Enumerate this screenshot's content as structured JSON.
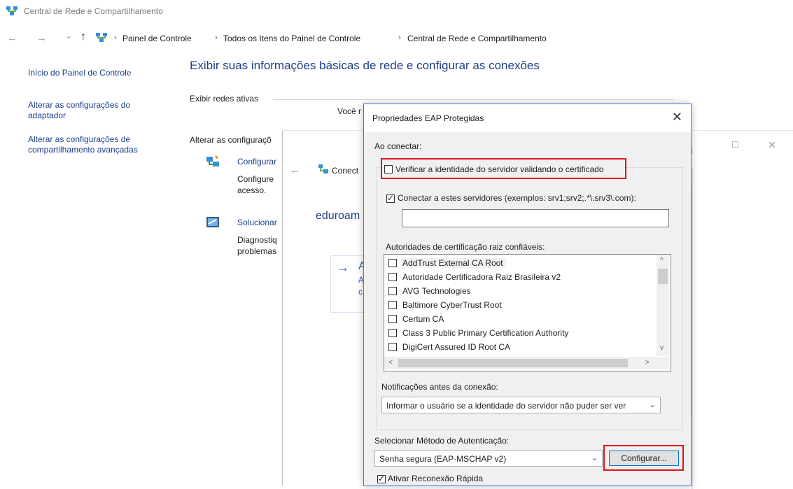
{
  "window": {
    "title": "Central de Rede e Compartilhamento"
  },
  "nav": {
    "back_glyph": "←",
    "forward_glyph": "→",
    "recent_glyph": "⌄",
    "up_glyph": "↑",
    "breadcrumb": [
      "Painel de Controle",
      "Todos os Itens do Painel de Controle",
      "Central de Rede e Compartilhamento"
    ],
    "separator": "›"
  },
  "sidebar": {
    "items": [
      {
        "label_1": "Início do Painel de Controle",
        "label_2": ""
      },
      {
        "label_1": "Alterar as configurações do",
        "label_2": "adaptador"
      },
      {
        "label_1": "Alterar as configurações de",
        "label_2": "compartilhamento avançadas"
      }
    ]
  },
  "main": {
    "heading": "Exibir suas informações básicas de rede e configurar as conexões",
    "active_networks_label": "Exibir redes ativas",
    "you_partial": "Você r",
    "change_settings_label": "Alterar as configuraçõ",
    "task1": {
      "link": "Configurar",
      "line1": "Configure",
      "line2": "acesso."
    },
    "task2": {
      "link": "Solucionar",
      "line1": "Diagnostiq",
      "line2": "problemas"
    }
  },
  "middle_window": {
    "back_glyph": "←",
    "title_partial": "Conect",
    "network_name": "eduroam",
    "arrow_glyph": "→",
    "option_letter_1": "A",
    "option_letter_2": "A",
    "option_letter_3": "c",
    "controls": {
      "minimize": "—",
      "maximize": "☐",
      "close": "✕",
      "chevron": "‹"
    }
  },
  "dialog": {
    "title": "Propriedades EAP Protegidas",
    "close_glyph": "✕",
    "when_connecting": "Ao conectar:",
    "verify_server": {
      "label": "Verificar a identidade do servidor validando o certificado",
      "checked": false
    },
    "connect_servers": {
      "label": "Conectar a estes servidores (exemplos: srv1;srv2;.*\\.srv3\\.com):",
      "checked": true,
      "value": ""
    },
    "trusted_roots_label": "Autoridades de certificação raiz confiáveis:",
    "trusted_roots": [
      {
        "name": "AddTrust External CA Root",
        "checked": false
      },
      {
        "name": "Autoridade Certificadora Raiz Brasileira v2",
        "checked": false
      },
      {
        "name": "AVG Technologies",
        "checked": false
      },
      {
        "name": "Baltimore CyberTrust Root",
        "checked": false
      },
      {
        "name": "Certum CA",
        "checked": false
      },
      {
        "name": "Class 3 Public Primary Certification Authority",
        "checked": false
      },
      {
        "name": "DigiCert Assured ID Root CA",
        "checked": false
      }
    ],
    "scroll_up": "^",
    "scroll_down": "v",
    "scroll_left": "<",
    "scroll_right": ">",
    "notifications_label": "Notificações antes da conexão:",
    "notifications_value": "Informar o usuário se a identidade do servidor não puder ser ver",
    "auth_method_label": "Selecionar Método de Autenticação:",
    "auth_method_value": "Senha segura (EAP-MSCHAP v2)",
    "configure_button": "Configurar...",
    "fast_reconnect": {
      "label": "Ativar Reconexão Rápida",
      "checked": true
    }
  },
  "colors": {
    "link": "#1a3f8f",
    "heading": "#1e3f8a",
    "highlight_box": "#e0131a",
    "dialog_border": "#3a7fd6"
  }
}
